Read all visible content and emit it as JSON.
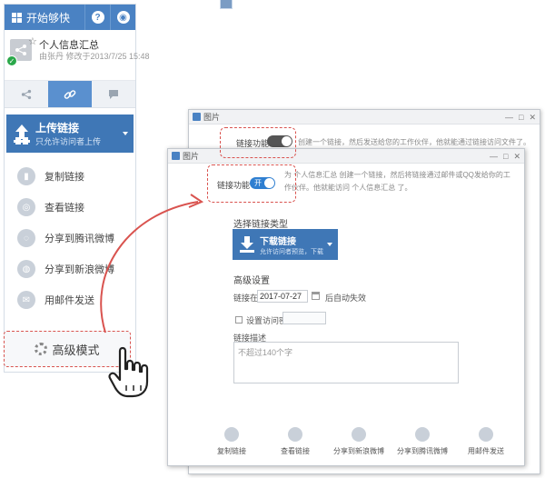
{
  "panel": {
    "title": "开始够快",
    "help_icon": "question-icon",
    "globe_icon": "globe-icon",
    "file_name": "个人信息汇总",
    "file_meta": "由张丹 修改于2013/7/25 15:48",
    "upload": {
      "label": "上传链接",
      "sub": "只允许访问者上传"
    },
    "actions": [
      {
        "label": "复制链接",
        "icon": "copy-icon"
      },
      {
        "label": "查看链接",
        "icon": "view-icon"
      },
      {
        "label": "分享到腾讯微博",
        "icon": "tencent-weibo-icon"
      },
      {
        "label": "分享到新浪微博",
        "icon": "sina-weibo-icon"
      },
      {
        "label": "用邮件发送",
        "icon": "mail-icon"
      }
    ],
    "advanced": "高级模式"
  },
  "back_dialog": {
    "title": "图片",
    "link_toggle_label": "链接功能",
    "desc": "创建一个链接，然后发送给您的工作伙伴，他就能通过链接访问文件了。"
  },
  "front_dialog": {
    "title": "图片",
    "link_toggle_label": "链接功能",
    "toggle_on": "开",
    "desc": "为 个人信息汇总 创建一个链接，然后将链接通过邮件或QQ发给你的工作伙伴。他就能访问 个人信息汇总 了。",
    "type_section": "选择链接类型",
    "download": {
      "label": "下载链接",
      "sub": "允许访问者预览，下载"
    },
    "advanced_section": "高级设置",
    "expire_prefix": "链接在",
    "expire_date": "2017-07-27",
    "expire_suffix": "后自动失效",
    "password_label": "设置访问密码",
    "desc_label": "链接描述",
    "desc_placeholder": "不超过140个字",
    "shares": [
      {
        "label": "复制链接"
      },
      {
        "label": "查看链接"
      },
      {
        "label": "分享到新浪微博"
      },
      {
        "label": "分享到腾讯微博"
      },
      {
        "label": "用邮件发送"
      }
    ]
  }
}
